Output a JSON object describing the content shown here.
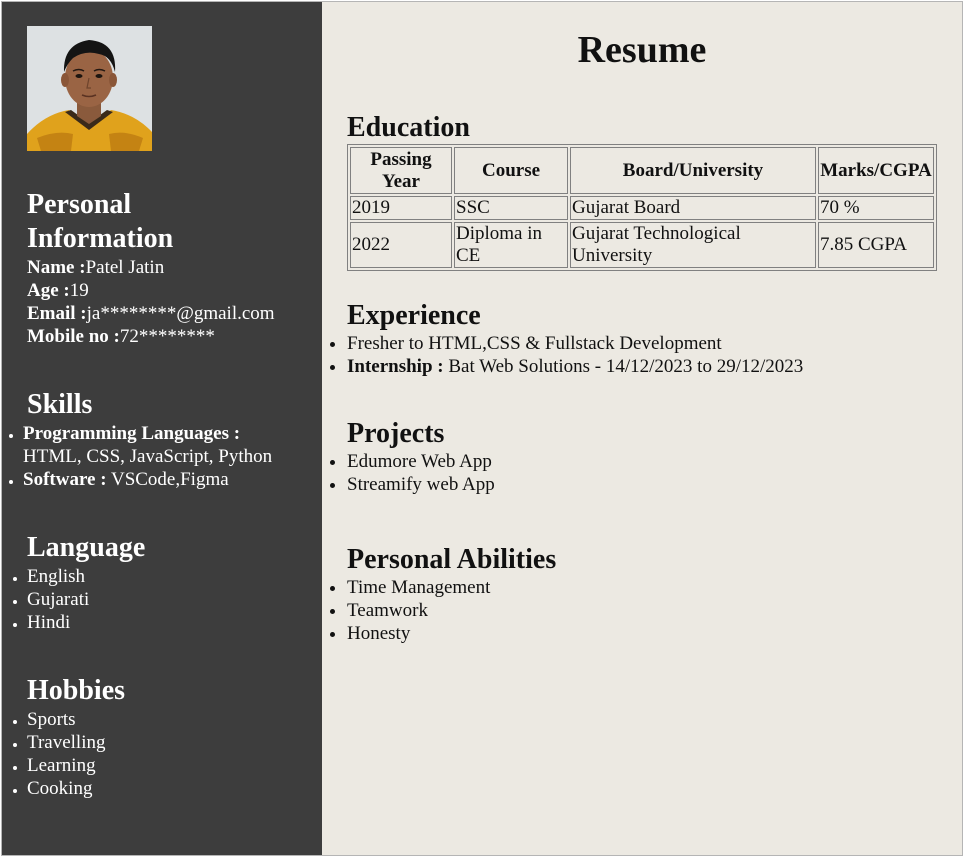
{
  "sidebar": {
    "personal": {
      "heading_line1": "Personal",
      "heading_line2": "Information",
      "name_label": "Name :",
      "name_value": "Patel Jatin",
      "age_label": "Age :",
      "age_value": "19",
      "email_label": "Email :",
      "email_value": "ja********@gmail.com",
      "mobile_label": "Mobile no :",
      "mobile_value": "72********"
    },
    "skills": {
      "heading": "Skills",
      "items": [
        {
          "label": "Programming Languages :",
          "value": "HTML, CSS, JavaScript, Python"
        },
        {
          "label": "Software :",
          "value": "VSCode,Figma"
        }
      ]
    },
    "language": {
      "heading": "Language",
      "items": [
        "English",
        "Gujarati",
        "Hindi"
      ]
    },
    "hobbies": {
      "heading": "Hobbies",
      "items": [
        "Sports",
        "Travelling",
        "Learning",
        "Cooking"
      ]
    },
    "colors": {
      "background": "#3d3d3d",
      "text": "#ffffff"
    }
  },
  "main": {
    "title": "Resume",
    "education": {
      "heading": "Education",
      "headers": [
        "Passing Year",
        "Course",
        "Board/University",
        "Marks/CGPA"
      ],
      "rows": [
        [
          "2019",
          "SSC",
          "Gujarat Board",
          "70 %"
        ],
        [
          "2022",
          "Diploma in CE",
          "Gujarat Technological University",
          "7.85 CGPA"
        ]
      ]
    },
    "experience": {
      "heading": "Experience",
      "fresher": "Fresher to HTML,CSS & Fullstack Development",
      "internship_label": "Internship :",
      "internship_value": "Bat Web Solutions - 14/12/2023 to 29/12/2023"
    },
    "projects": {
      "heading": "Projects",
      "items": [
        "Edumore Web App",
        "Streamify web App"
      ]
    },
    "abilities": {
      "heading": "Personal Abilities",
      "items": [
        "Time Management",
        "Teamwork",
        "Honesty"
      ]
    },
    "colors": {
      "background": "#ece9e2",
      "text": "#111111"
    }
  },
  "icons": {
    "photo": "profile-photo"
  }
}
